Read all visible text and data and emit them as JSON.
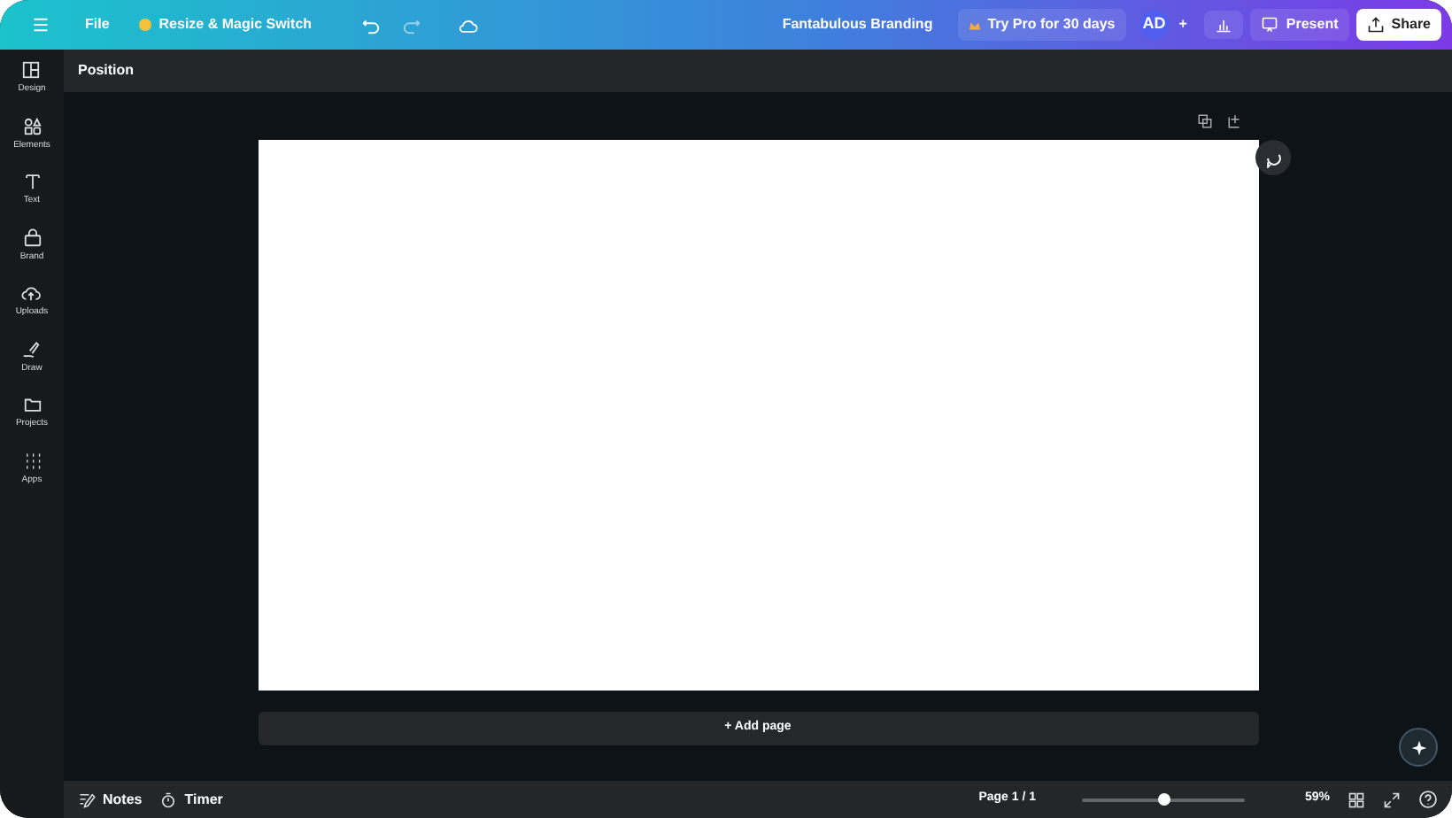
{
  "topbar": {
    "menu": "File",
    "resize": "Resize & Magic Switch",
    "design_title": "Fantabulous Branding",
    "try_pro": "Try Pro for 30 days",
    "avatar": "AD",
    "plus": "+",
    "present": "Present",
    "share": "Share"
  },
  "sidebar": {
    "items": [
      {
        "label": "Design"
      },
      {
        "label": "Elements"
      },
      {
        "label": "Text"
      },
      {
        "label": "Brand"
      },
      {
        "label": "Uploads"
      },
      {
        "label": "Draw"
      },
      {
        "label": "Projects"
      },
      {
        "label": "Apps"
      }
    ]
  },
  "toolbar": {
    "label": "Position"
  },
  "canvas": {
    "add_page": "+ Add page"
  },
  "bottom_bar": {
    "notes": "Notes",
    "timer": "Timer",
    "page": "Page 1 / 1",
    "zoom": {
      "level": 0.51
    },
    "zoom_reading": "59%"
  }
}
